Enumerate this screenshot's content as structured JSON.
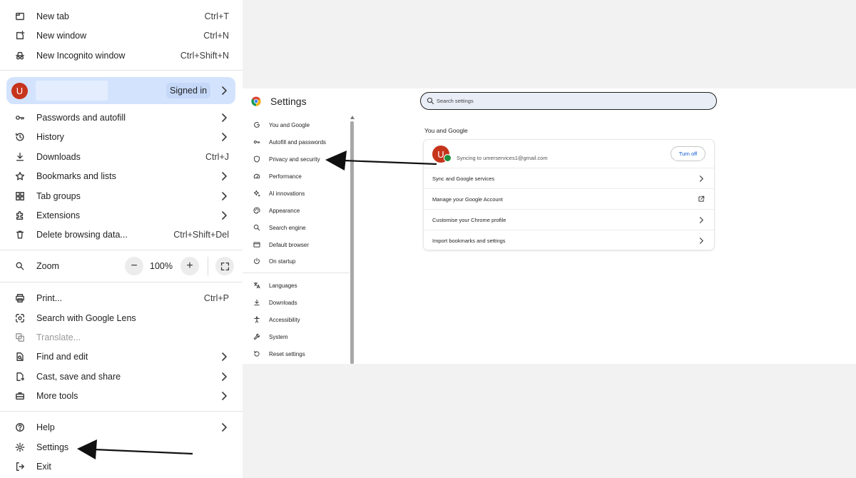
{
  "menu": {
    "items_top": [
      {
        "label": "New tab",
        "shortcut": "Ctrl+T",
        "icon": "new-tab-icon"
      },
      {
        "label": "New window",
        "shortcut": "Ctrl+N",
        "icon": "new-window-icon"
      },
      {
        "label": "New Incognito window",
        "shortcut": "Ctrl+Shift+N",
        "icon": "incognito-icon"
      }
    ],
    "profile": {
      "avatar_letter": "U",
      "status": "Signed in"
    },
    "items_mid": [
      {
        "label": "Passwords and autofill",
        "icon": "key-icon"
      },
      {
        "label": "History",
        "icon": "history-icon"
      },
      {
        "label": "Downloads",
        "shortcut": "Ctrl+J",
        "icon": "download-icon"
      },
      {
        "label": "Bookmarks and lists",
        "icon": "star-icon"
      },
      {
        "label": "Tab groups",
        "icon": "tab-groups-icon"
      },
      {
        "label": "Extensions",
        "icon": "puzzle-icon"
      },
      {
        "label": "Delete browsing data...",
        "shortcut": "Ctrl+Shift+Del",
        "icon": "trash-icon"
      }
    ],
    "zoom": {
      "label": "Zoom",
      "value": "100%",
      "minus": "−",
      "plus": "+"
    },
    "items_tools": [
      {
        "label": "Print...",
        "shortcut": "Ctrl+P",
        "icon": "print-icon"
      },
      {
        "label": "Search with Google Lens",
        "icon": "lens-icon"
      },
      {
        "label": "Translate...",
        "icon": "translate-icon"
      },
      {
        "label": "Find and edit",
        "icon": "find-icon"
      },
      {
        "label": "Cast, save and share",
        "icon": "cast-icon"
      },
      {
        "label": "More tools",
        "icon": "toolbox-icon"
      }
    ],
    "items_bottom": [
      {
        "label": "Help",
        "icon": "help-icon"
      },
      {
        "label": "Settings",
        "icon": "gear-icon"
      },
      {
        "label": "Exit",
        "icon": "exit-icon"
      }
    ]
  },
  "settings": {
    "title": "Settings",
    "search_placeholder": "Search settings",
    "nav": [
      {
        "label": "You and Google",
        "icon": "google-g-icon"
      },
      {
        "label": "Autofill and passwords",
        "icon": "key-icon"
      },
      {
        "label": "Privacy and security",
        "icon": "shield-icon"
      },
      {
        "label": "Performance",
        "icon": "speedometer-icon"
      },
      {
        "label": "AI innovations",
        "icon": "sparkle-icon"
      },
      {
        "label": "Appearance",
        "icon": "palette-icon"
      },
      {
        "label": "Search engine",
        "icon": "search-icon"
      },
      {
        "label": "Default browser",
        "icon": "browser-window-icon"
      },
      {
        "label": "On startup",
        "icon": "power-icon"
      },
      {
        "label": "Languages",
        "icon": "translate-icon"
      },
      {
        "label": "Downloads",
        "icon": "download-icon"
      },
      {
        "label": "Accessibility",
        "icon": "accessibility-icon"
      },
      {
        "label": "System",
        "icon": "wrench-icon"
      },
      {
        "label": "Reset settings",
        "icon": "reset-icon"
      }
    ],
    "section_title": "You and Google",
    "card": {
      "avatar_letter": "U",
      "sync_text": "Syncing to umerservices1@gmail.com",
      "turn_off_label": "Turn off",
      "rows": [
        {
          "label": "Sync and Google services",
          "action": "chevron"
        },
        {
          "label": "Manage your Google Account",
          "action": "external"
        },
        {
          "label": "Customise your Chrome profile",
          "action": "chevron"
        },
        {
          "label": "Import bookmarks and settings",
          "action": "chevron"
        }
      ]
    }
  },
  "colors": {
    "accent_blue": "#0b57d0",
    "profile_bg": "#d3e3fd",
    "avatar_red": "#c6341c",
    "sync_green": "#1e8e3e"
  }
}
